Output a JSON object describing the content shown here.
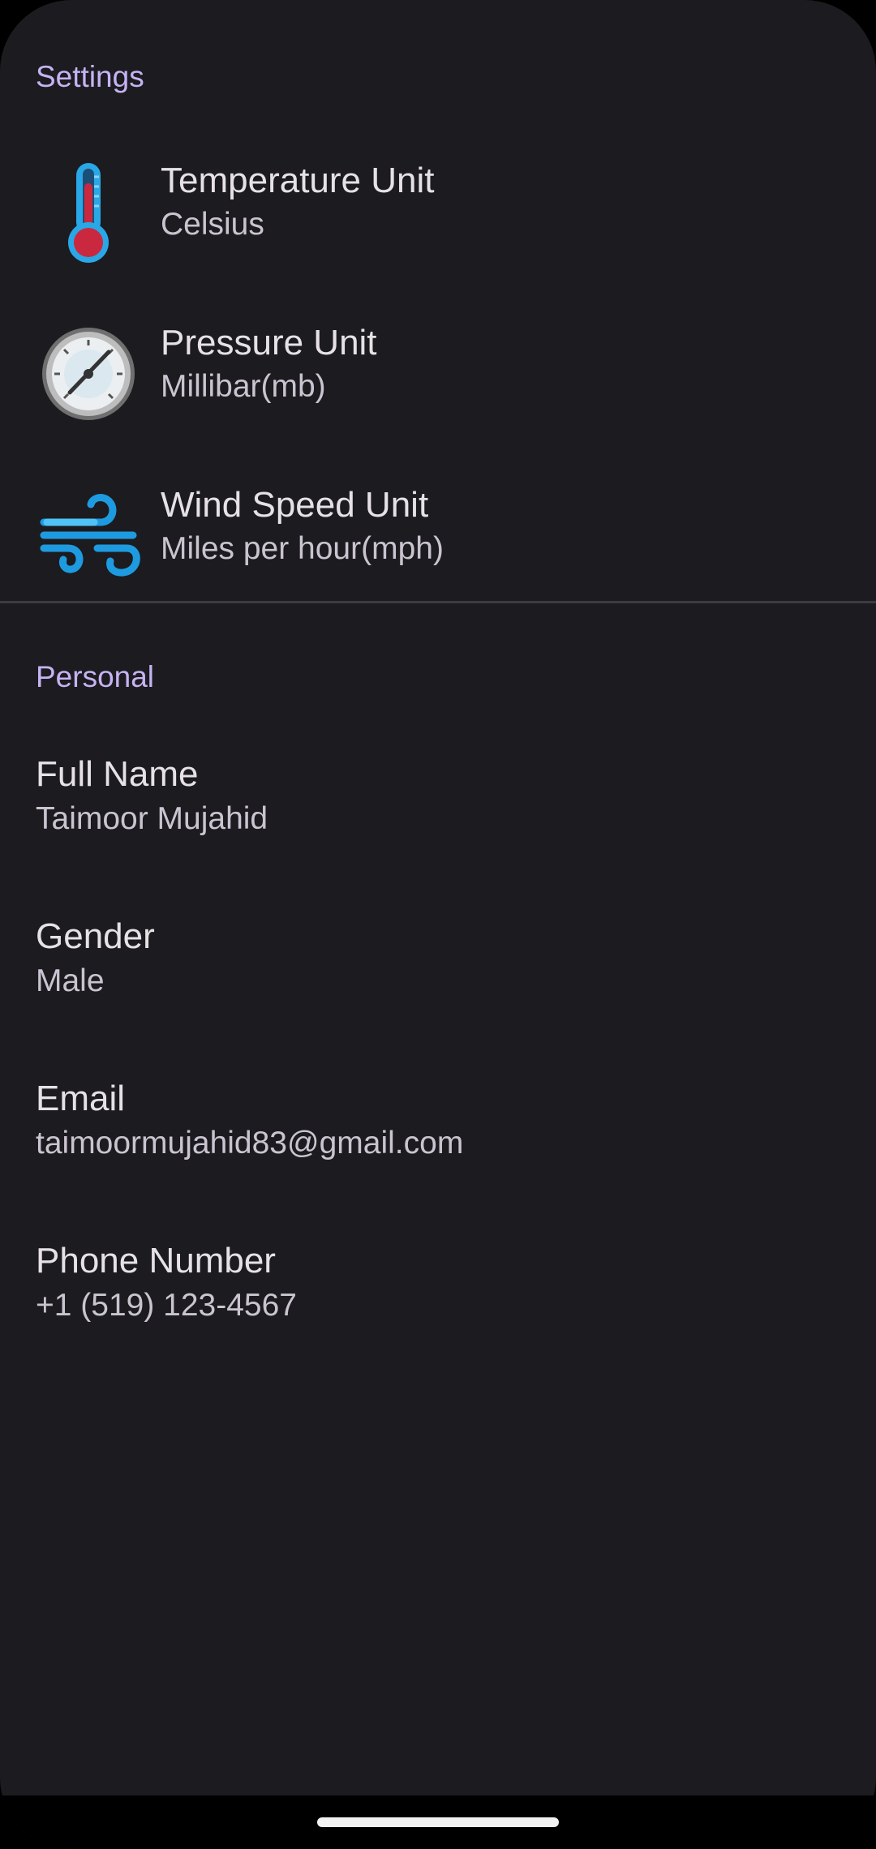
{
  "settings": {
    "header": "Settings",
    "items": [
      {
        "title": "Temperature Unit",
        "summary": "Celsius",
        "icon": "thermometer-icon"
      },
      {
        "title": "Pressure Unit",
        "summary": "Millibar(mb)",
        "icon": "pressure-gauge-icon"
      },
      {
        "title": "Wind Speed Unit",
        "summary": "Miles per hour(mph)",
        "icon": "wind-icon"
      }
    ]
  },
  "personal": {
    "header": "Personal",
    "items": [
      {
        "title": "Full Name",
        "summary": "Taimoor Mujahid"
      },
      {
        "title": "Gender",
        "summary": "Male"
      },
      {
        "title": "Email",
        "summary": "taimoormujahid83@gmail.com"
      },
      {
        "title": "Phone Number",
        "summary": "+1 (519) 123-4567"
      }
    ]
  },
  "colors": {
    "background": "#1c1b1f",
    "header_accent": "#d0bcff",
    "thermometer_blue": "#29a6e8",
    "thermometer_red": "#c9283e",
    "wind_blue": "#1e9be0"
  }
}
